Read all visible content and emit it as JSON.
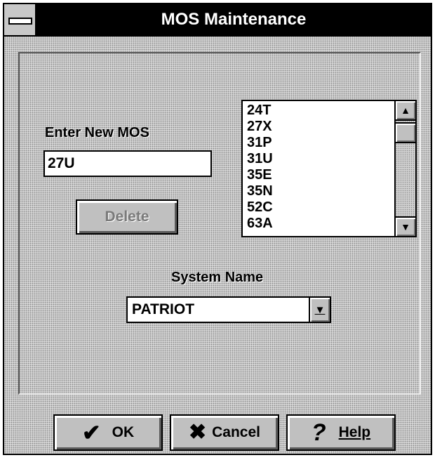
{
  "window": {
    "title": "MOS Maintenance"
  },
  "form": {
    "new_mos_label": "Enter New MOS",
    "new_mos_value": "27U",
    "delete_label": "Delete",
    "mos_list": [
      "24T",
      "27X",
      "31P",
      "31U",
      "35E",
      "35N",
      "52C",
      "63A"
    ],
    "system_name_label": "System Name",
    "system_name_value": "PATRIOT"
  },
  "buttons": {
    "ok_label": "OK",
    "cancel_label": "Cancel",
    "help_label": "Help"
  },
  "icons": {
    "ok": "checkmark-icon",
    "cancel": "x-mark-icon",
    "help": "question-mark-icon"
  }
}
